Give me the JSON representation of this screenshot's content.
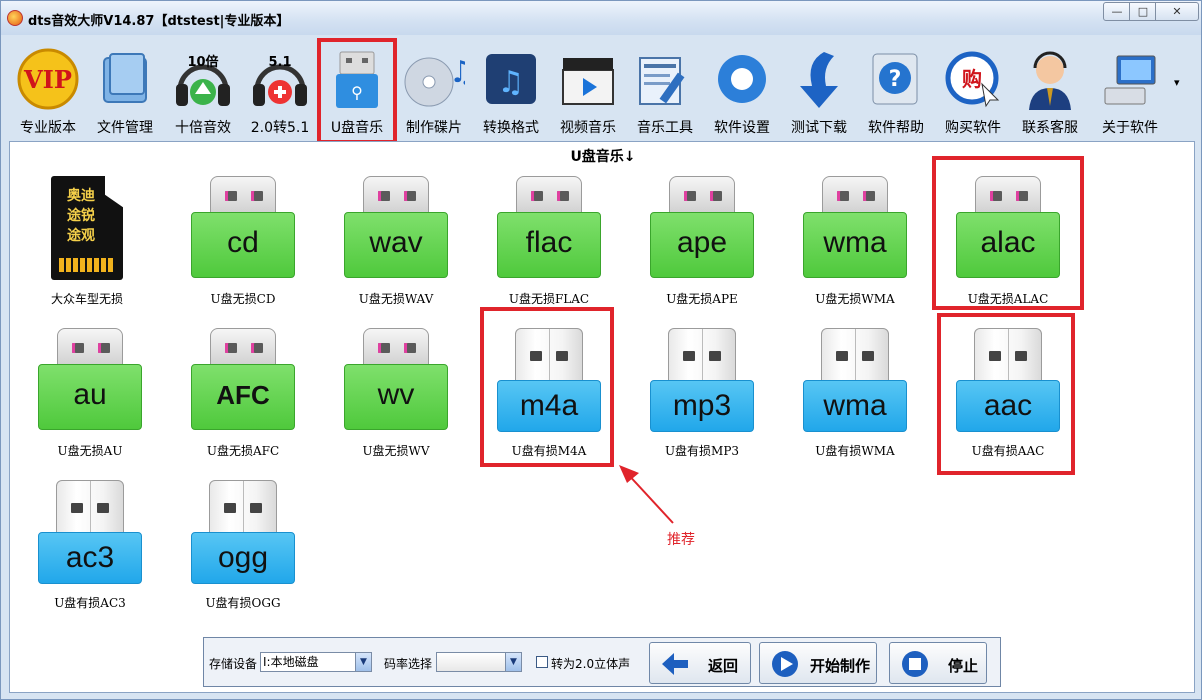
{
  "window": {
    "title": "dts音效大师V14.87【dtstest|专业版本】",
    "controls": {
      "min": "—",
      "max": "□",
      "close": "✕"
    }
  },
  "toolbar": {
    "items": [
      {
        "label": "专业版本",
        "icon": "vip-icon"
      },
      {
        "label": "文件管理",
        "icon": "file-manager-icon"
      },
      {
        "label": "十倍音效",
        "icon": "tenfold-headphones-icon",
        "badge": "10倍"
      },
      {
        "label": "2.0转5.1",
        "icon": "surround-headphones-icon",
        "badge": "5.1"
      },
      {
        "label": "U盘音乐",
        "icon": "usb-drive-icon"
      },
      {
        "label": "制作碟片",
        "icon": "disc-icon"
      },
      {
        "label": "转换格式",
        "icon": "music-note-icon"
      },
      {
        "label": "视频音乐",
        "icon": "clapper-icon"
      },
      {
        "label": "音乐工具",
        "icon": "tools-icon"
      },
      {
        "label": "软件设置",
        "icon": "gear-icon"
      },
      {
        "label": "测试下载",
        "icon": "download-arrow-icon"
      },
      {
        "label": "软件帮助",
        "icon": "help-icon"
      },
      {
        "label": "购买软件",
        "icon": "buy-icon",
        "badge": "购"
      },
      {
        "label": "联系客服",
        "icon": "support-agent-icon"
      },
      {
        "label": "关于软件",
        "icon": "about-computer-icon"
      }
    ],
    "overflow": "▾"
  },
  "panel": {
    "title": "U盘音乐↓",
    "car_tile": {
      "label": "大众车型无损",
      "card_text": [
        "奥迪",
        "途锐",
        "途观"
      ]
    },
    "tiles": [
      {
        "text": "cd",
        "label": "U盘无损CD",
        "kind": "green"
      },
      {
        "text": "wav",
        "label": "U盘无损WAV",
        "kind": "green"
      },
      {
        "text": "flac",
        "label": "U盘无损FLAC",
        "kind": "green"
      },
      {
        "text": "ape",
        "label": "U盘无损APE",
        "kind": "green"
      },
      {
        "text": "wma",
        "label": "U盘无损WMA",
        "kind": "green"
      },
      {
        "text": "alac",
        "label": "U盘无损ALAC",
        "kind": "green"
      },
      {
        "text": "au",
        "label": "U盘无损AU",
        "kind": "green"
      },
      {
        "text": "AFC",
        "label": "U盘无损AFC",
        "kind": "green"
      },
      {
        "text": "wv",
        "label": "U盘无损WV",
        "kind": "green"
      },
      {
        "text": "m4a",
        "label": "U盘有损M4A",
        "kind": "blue"
      },
      {
        "text": "mp3",
        "label": "U盘有损MP3",
        "kind": "blue"
      },
      {
        "text": "wma",
        "label": "U盘有损WMA",
        "kind": "blue"
      },
      {
        "text": "aac",
        "label": "U盘有损AAC",
        "kind": "blue"
      },
      {
        "text": "ac3",
        "label": "U盘有损AC3",
        "kind": "blue"
      },
      {
        "text": "ogg",
        "label": "U盘有损OGG",
        "kind": "blue"
      }
    ],
    "annotation": "推荐"
  },
  "bottom": {
    "storage_label": "存储设备",
    "storage_value": "I:本地磁盘",
    "bitrate_label": "码率选择",
    "bitrate_value": "",
    "stereo_label": "转为2.0立体声",
    "back_label": "返回",
    "start_label": "开始制作",
    "stop_label": "停止"
  },
  "colors": {
    "highlight": "#e0242b",
    "lossless": "#4fc93c",
    "lossy": "#21a7ea"
  }
}
